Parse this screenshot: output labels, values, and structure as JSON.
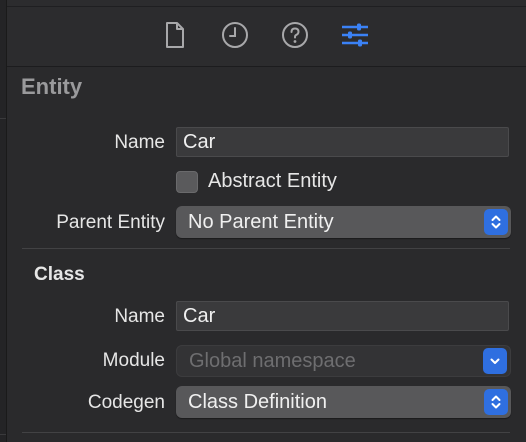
{
  "toolbar": {
    "icons": [
      "file-inspector-icon",
      "history-inspector-icon",
      "quick-help-icon",
      "attributes-inspector-icon"
    ],
    "accent": "#3b82f6"
  },
  "entity": {
    "title": "Entity",
    "name_label": "Name",
    "name_value": "Car",
    "abstract_label": "Abstract Entity",
    "abstract_checked": false,
    "parent_label": "Parent Entity",
    "parent_value": "No Parent Entity"
  },
  "class": {
    "title": "Class",
    "name_label": "Name",
    "name_value": "Car",
    "module_label": "Module",
    "module_value": "Global namespace",
    "codegen_label": "Codegen",
    "codegen_value": "Class Definition"
  }
}
